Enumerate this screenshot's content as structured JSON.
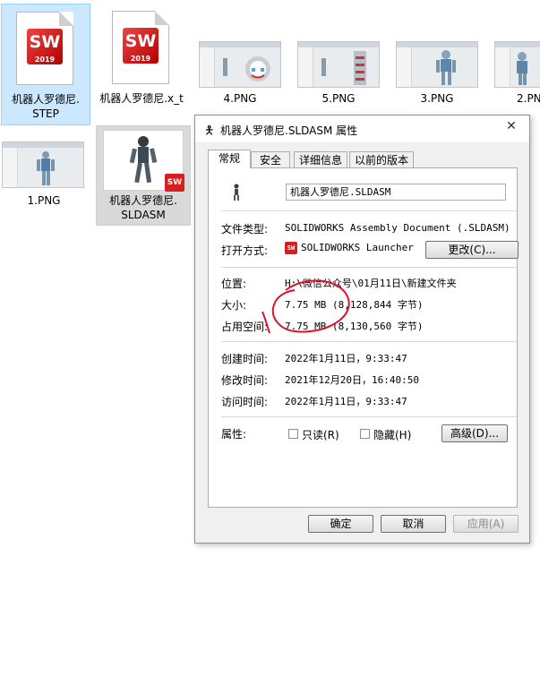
{
  "files": [
    {
      "name": "机器人罗德尼.\nSTEP",
      "type": "step",
      "badge_main": "SW",
      "badge_year": "2019"
    },
    {
      "name": "机器人罗德尼.x_t",
      "type": "x_t",
      "badge_main": "SW",
      "badge_year": "2019"
    },
    {
      "name": "4.PNG",
      "type": "png"
    },
    {
      "name": "5.PNG",
      "type": "png"
    },
    {
      "name": "3.PNG",
      "type": "png"
    },
    {
      "name": "2.PN",
      "type": "png"
    },
    {
      "name": "1.PNG",
      "type": "png"
    },
    {
      "name": "机器人罗德尼.\nSLDASM",
      "type": "sldasm",
      "badge_main": "SW"
    }
  ],
  "dialog": {
    "title": "机器人罗德尼.SLDASM 属性",
    "close_label": "✕",
    "tabs": [
      "常规",
      "安全",
      "详细信息",
      "以前的版本"
    ],
    "active_tab": "常规",
    "filename": "机器人罗德尼.SLDASM",
    "file_type_label": "文件类型:",
    "file_type_value": "SOLIDWORKS Assembly Document (.SLDASM)",
    "open_with_label": "打开方式:",
    "open_with_value": "SOLIDWORKS Launcher",
    "open_with_icon": "SW",
    "change_button": "更改(C)...",
    "location_label": "位置:",
    "location_value": "H:\\微信公众号\\01月11日\\新建文件夹",
    "size_label": "大小:",
    "size_value": "7.75 MB (8,128,844 字节)",
    "size_on_disk_label": "占用空间:",
    "size_on_disk_value": "7.75 MB (8,130,560 字节)",
    "created_label": "创建时间:",
    "created_value": "2022年1月11日，9:33:47",
    "modified_label": "修改时间:",
    "modified_value": "2021年12月20日，16:40:50",
    "accessed_label": "访问时间:",
    "accessed_value": "2022年1月11日，9:33:47",
    "attributes_label": "属性:",
    "readonly_label": "只读(R)",
    "hidden_label": "隐藏(H)",
    "advanced_button": "高级(D)...",
    "ok_button": "确定",
    "cancel_button": "取消",
    "apply_button": "应用(A)"
  },
  "colors": {
    "annotation": "#e0102a",
    "selection": "#cce8ff",
    "sw_red": "#d81e1e"
  }
}
